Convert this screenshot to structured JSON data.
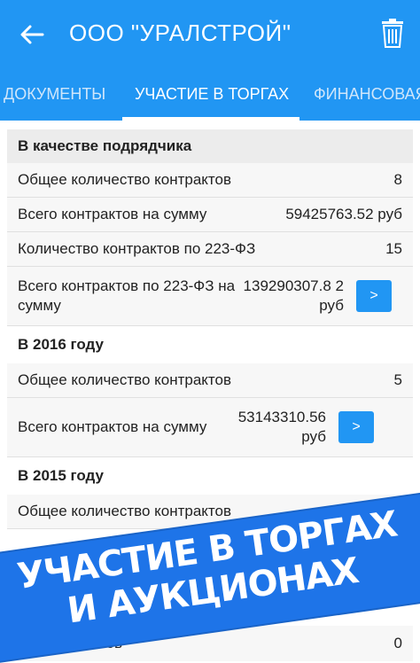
{
  "appbar": {
    "title": "ООО \"УРАЛСТРОЙ\"",
    "back_icon": "arrow-left-icon",
    "trash_icon": "trash-icon"
  },
  "tabs": [
    {
      "label": "ДОКУМЕНТЫ"
    },
    {
      "label": "УЧАСТИЕ В ТОРГАХ"
    },
    {
      "label": "ФИНАНСОВАЯ"
    }
  ],
  "sections": {
    "contractor": {
      "header": "В качестве подрядчика",
      "rows": [
        {
          "label": "Общее количество контрактов",
          "value": "8"
        },
        {
          "label": "Всего контрактов на сумму",
          "value": "59425763.52 руб"
        },
        {
          "label": "Количество контрактов по 223-ФЗ",
          "value": "15"
        },
        {
          "label": "Всего контрактов по 223-ФЗ на сумму",
          "value": "139290307.8 2 руб",
          "button": ">"
        }
      ]
    },
    "y2016": {
      "header": "В 2016 году",
      "rows": [
        {
          "label": "Общее количество контрактов",
          "value": "5"
        },
        {
          "label": "Всего контрактов на сумму",
          "value": "53143310.56 руб",
          "button": ">"
        }
      ]
    },
    "y2015": {
      "header": "В 2015 году",
      "rows": [
        {
          "label": "Общее количество контрактов"
        }
      ]
    }
  },
  "banner": {
    "line1": "УЧАСТИЕ В ТОРГАХ",
    "line2": "И АУКЦИОНАХ"
  },
  "bottom_row": {
    "label": "…о контрактов",
    "value": "0"
  },
  "colors": {
    "primary": "#2196f3",
    "banner": "#1e74e8"
  }
}
